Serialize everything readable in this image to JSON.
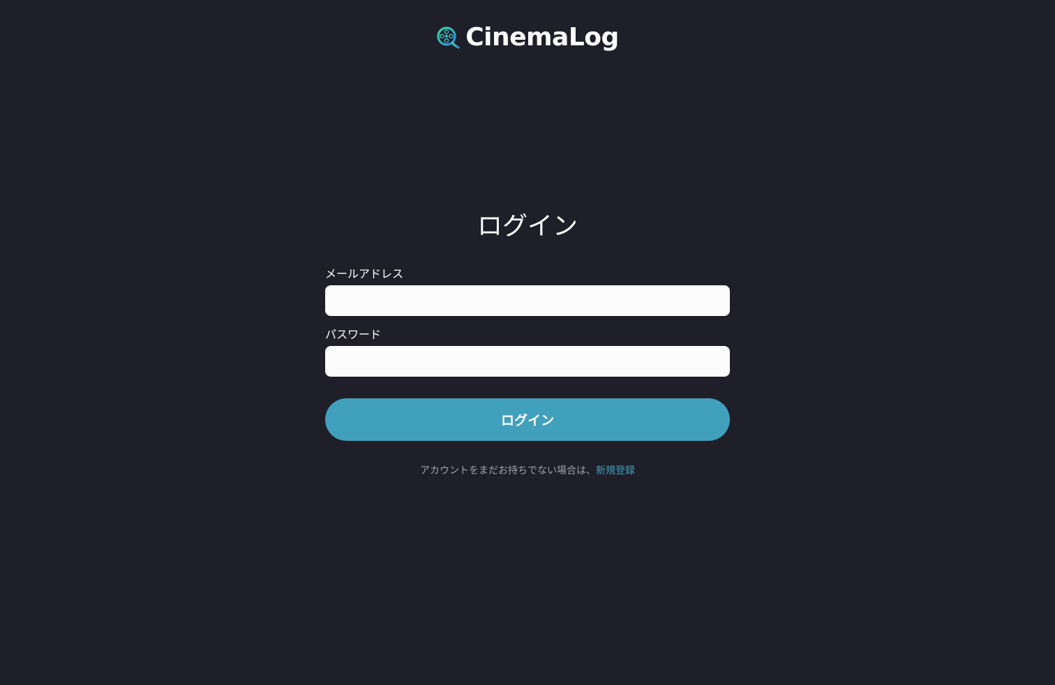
{
  "app": {
    "name": "CinemaLog",
    "logo_icon": "film-reel-magnifier-icon"
  },
  "colors": {
    "background": "#1f1f29",
    "accent": "#41a0bc",
    "input_background": "#fcfcfd",
    "muted_text": "#a0a2ad"
  },
  "login": {
    "title": "ログイン",
    "email_label": "メールアドレス",
    "email_value": "",
    "password_label": "パスワード",
    "password_value": "",
    "submit_label": "ログイン"
  },
  "signup": {
    "prompt": "アカウントをまだお持ちでない場合は、",
    "link_label": "新規登録"
  }
}
